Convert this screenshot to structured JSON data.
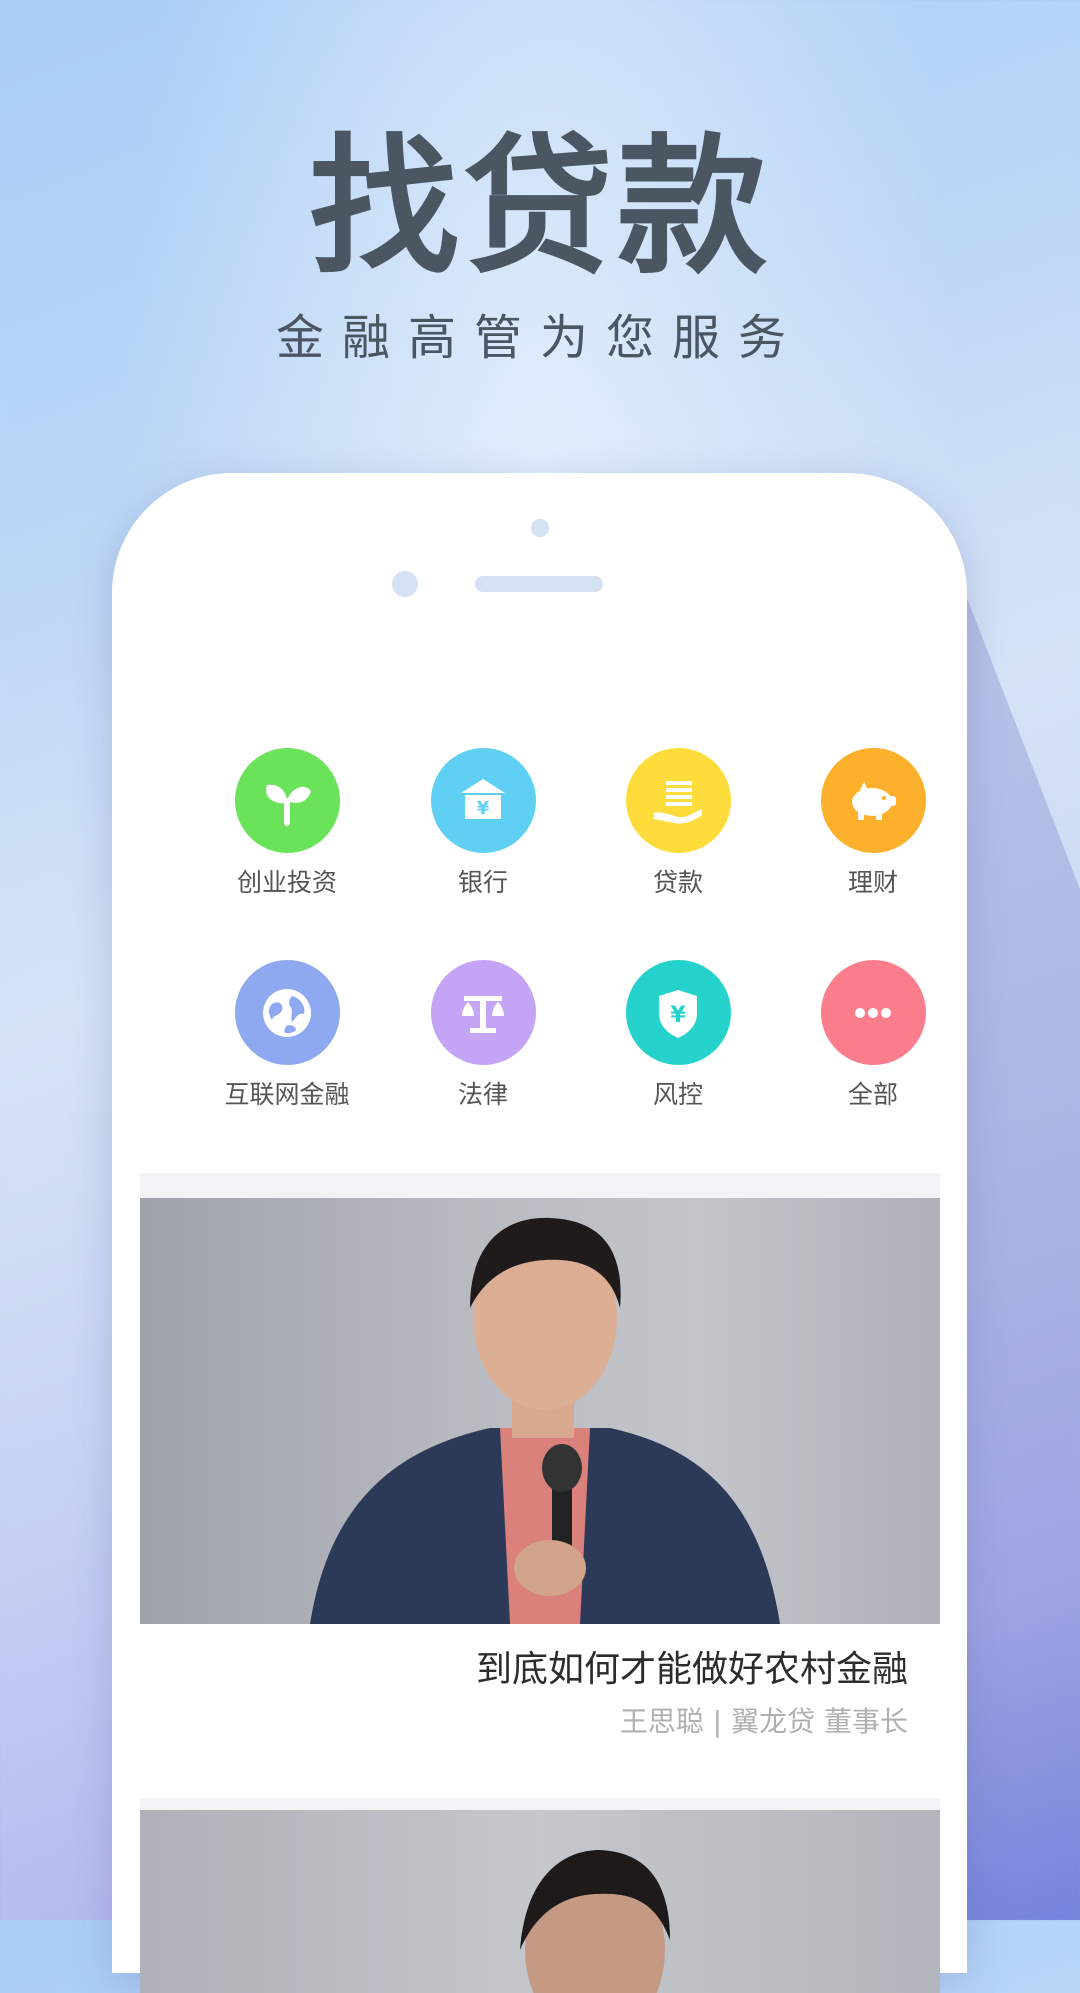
{
  "hero": {
    "title": "找贷款",
    "subtitle": "金融高管为您服务"
  },
  "categories": [
    {
      "label": "创业投资",
      "icon": "sprout-icon",
      "color": "#6ae35a"
    },
    {
      "label": "银行",
      "icon": "bank-icon",
      "color": "#5fcff4"
    },
    {
      "label": "贷款",
      "icon": "loan-hand-icon",
      "color": "#fddc3c"
    },
    {
      "label": "理财",
      "icon": "piggy-bank-icon",
      "color": "#fdb02b"
    },
    {
      "label": "互联网金融",
      "icon": "globe-icon",
      "color": "#8ea9f0"
    },
    {
      "label": "法律",
      "icon": "scales-icon",
      "color": "#c4a4f4"
    },
    {
      "label": "风控",
      "icon": "shield-yen-icon",
      "color": "#25d3cc"
    },
    {
      "label": "全部",
      "icon": "more-icon",
      "color": "#fc7e8d"
    }
  ],
  "articles": [
    {
      "title": "到底如何才能做好农村金融",
      "meta": "王思聪 | 翼龙贷  董事长"
    }
  ]
}
